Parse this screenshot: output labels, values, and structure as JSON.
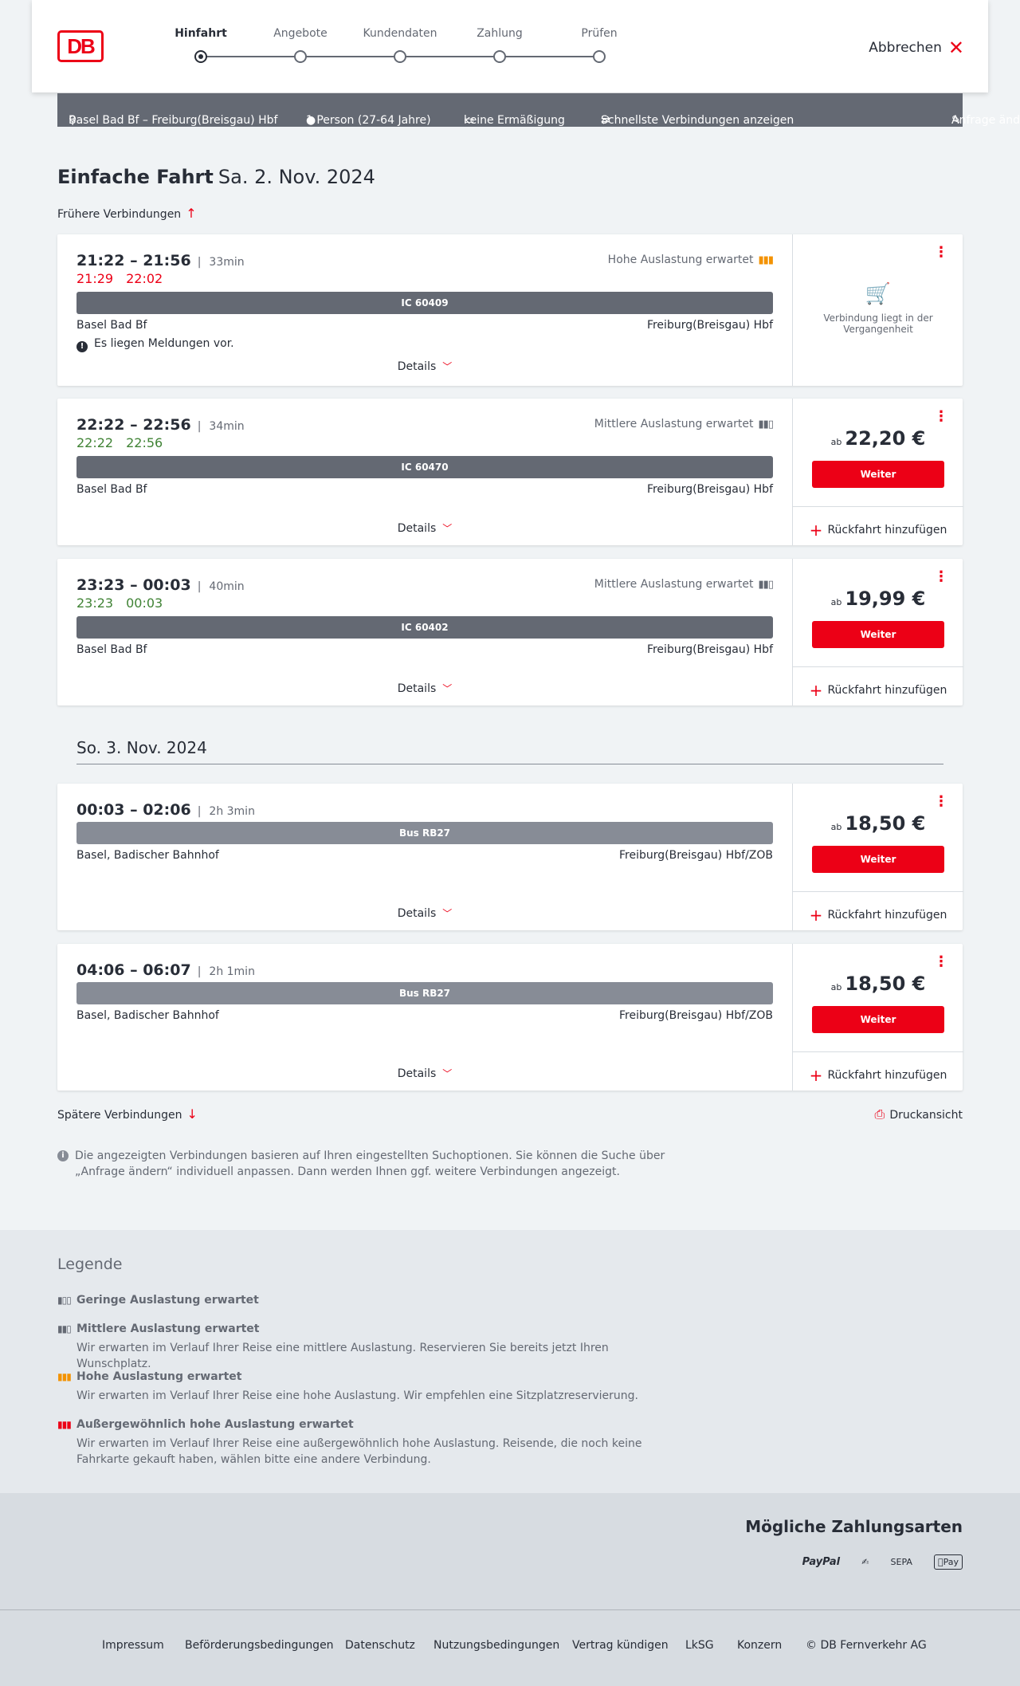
{
  "header": {
    "logo": "DB",
    "steps": [
      "Hinfahrt",
      "Angebote",
      "Kundendaten",
      "Zahlung",
      "Prüfen"
    ],
    "cancel": "Abbrechen"
  },
  "query": {
    "route": "Basel Bad Bf – Freiburg(Breisgau) Hbf",
    "persons": "1 Person (27-64 Jahre)",
    "discount": "keine Ermäßigung",
    "fastest": "Schnellste Verbindungen anzeigen",
    "change": "Anfrage ändern"
  },
  "title": {
    "main": "Einfache Fahrt",
    "date": "Sa. 2. Nov. 2024"
  },
  "earlier": "Frühere Verbindungen",
  "later": "Spätere Verbindungen",
  "print": "Druckansicht",
  "details_label": "Details",
  "weiter_label": "Weiter",
  "ruckfahrt_label": "Rückfahrt hinzufügen",
  "ab_label": "ab",
  "second_day": "So. 3. Nov. 2024",
  "connections": [
    {
      "times": "21:22 – 21:56",
      "duration": "33min",
      "rt_dep": "21:29",
      "rt_arr": "22:02",
      "occupancy": "Hohe Auslastung erwartet",
      "train": "IC 60409",
      "from": "Basel Bad Bf",
      "to": "Freiburg(Breisgau) Hbf",
      "message": "Es liegen Meldungen vor.",
      "past_text": "Verbindung liegt in der Vergangenheit"
    },
    {
      "times": "22:22 – 22:56",
      "duration": "34min",
      "rt_dep": "22:22",
      "rt_arr": "22:56",
      "occupancy": "Mittlere Auslastung erwartet",
      "train": "IC 60470",
      "from": "Basel Bad Bf",
      "to": "Freiburg(Breisgau) Hbf",
      "price": "22,20 €"
    },
    {
      "times": "23:23 – 00:03",
      "duration": "40min",
      "rt_dep": "23:23",
      "rt_arr": "00:03",
      "occupancy": "Mittlere Auslastung erwartet",
      "train": "IC 60402",
      "from": "Basel Bad Bf",
      "to": "Freiburg(Breisgau) Hbf",
      "price": "19,99 €"
    },
    {
      "times": "00:03 – 02:06",
      "duration": "2h 3min",
      "train": "Bus RB27",
      "from": "Basel, Badischer Bahnhof",
      "to": "Freiburg(Breisgau) Hbf/ZOB",
      "price": "18,50 €"
    },
    {
      "times": "04:06 – 06:07",
      "duration": "2h 1min",
      "train": "Bus RB27",
      "from": "Basel, Badischer Bahnhof",
      "to": "Freiburg(Breisgau) Hbf/ZOB",
      "price": "18,50 €"
    }
  ],
  "info_text": "Die angezeigten Verbindungen basieren auf Ihren eingestellten Suchoptionen. Sie können die Suche über „Anfrage ändern“ individuell anpassen. Dann werden Ihnen ggf. weitere Verbindungen angezeigt.",
  "legend": {
    "title": "Legende",
    "items": [
      {
        "label": "Geringe Auslastung erwartet",
        "desc": ""
      },
      {
        "label": "Mittlere Auslastung erwartet",
        "desc": "Wir erwarten im Verlauf Ihrer Reise eine mittlere Auslastung. Reservieren Sie bereits jetzt Ihren Wunschplatz."
      },
      {
        "label": "Hohe Auslastung erwartet",
        "desc": "Wir erwarten im Verlauf Ihrer Reise eine hohe Auslastung. Wir empfehlen eine Sitzplatzreservierung."
      },
      {
        "label": "Außergewöhnlich hohe Auslastung erwartet",
        "desc": "Wir erwarten im Verlauf Ihrer Reise eine außergewöhnlich hohe Auslastung. Reisende, die noch keine Fahrkarte gekauft haben, wählen bitte eine andere Verbindung."
      }
    ]
  },
  "payment": {
    "title": "Mögliche Zahlungsarten",
    "paypal": "PayPal",
    "sepa": "SEPA",
    "applepay": "Pay"
  },
  "footer": [
    "Impressum",
    "Beförderungsbedingungen",
    "Datenschutz",
    "Nutzungsbedingungen",
    "Vertrag kündigen",
    "LkSG",
    "Konzern",
    "© DB Fernverkehr AG"
  ],
  "colors": {
    "accent": "#ec0016",
    "on_time": "#408335",
    "bar": "#646973",
    "high_load": "#f39200"
  }
}
